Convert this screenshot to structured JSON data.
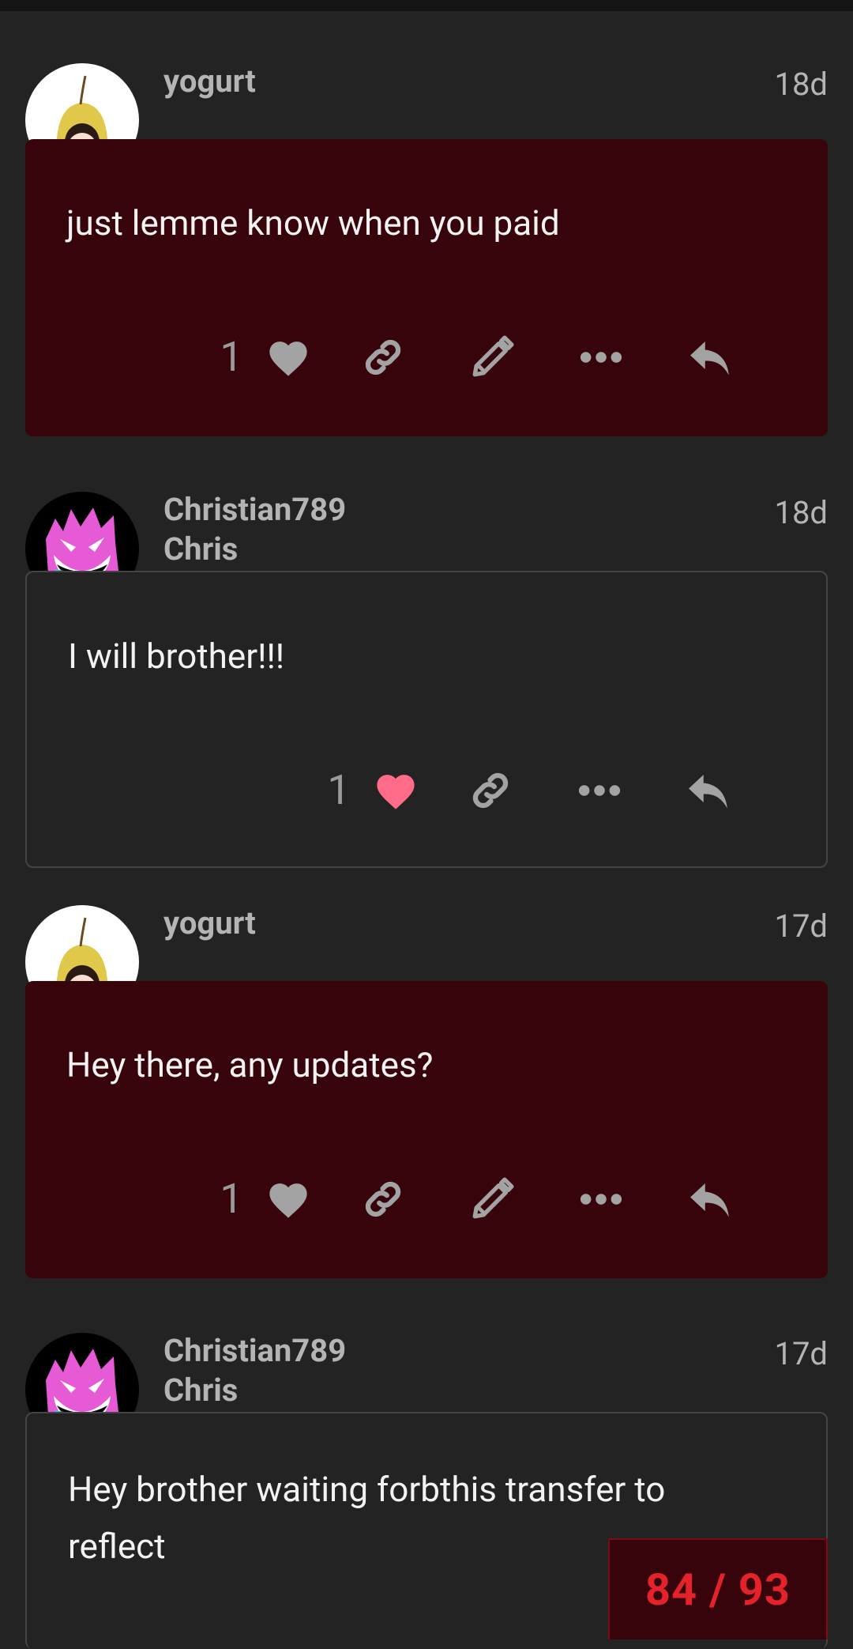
{
  "posts": [
    {
      "username": "yogurt",
      "fullname": "",
      "date": "18d",
      "body": "just lemme know when you paid",
      "like_count": "1",
      "liked": false
    },
    {
      "username": "Christian789",
      "fullname": "Chris",
      "date": "18d",
      "body": "I will brother!!!",
      "like_count": "1",
      "liked": true
    },
    {
      "username": "yogurt",
      "fullname": "",
      "date": "17d",
      "body": "Hey there, any updates?",
      "like_count": "1",
      "liked": false
    },
    {
      "username": "Christian789",
      "fullname": "Chris",
      "date": "17d",
      "body": "Hey brother waiting forbthis transfer to reflect"
    }
  ],
  "progress": {
    "label": "84 / 93"
  },
  "colors": {
    "highlight_bg": "#36040a",
    "liked_heart": "#ff6b88",
    "progress_text": "#e3222b"
  },
  "icons": [
    "heart-icon",
    "link-icon",
    "pencil-icon",
    "more-icon",
    "reply-icon"
  ]
}
